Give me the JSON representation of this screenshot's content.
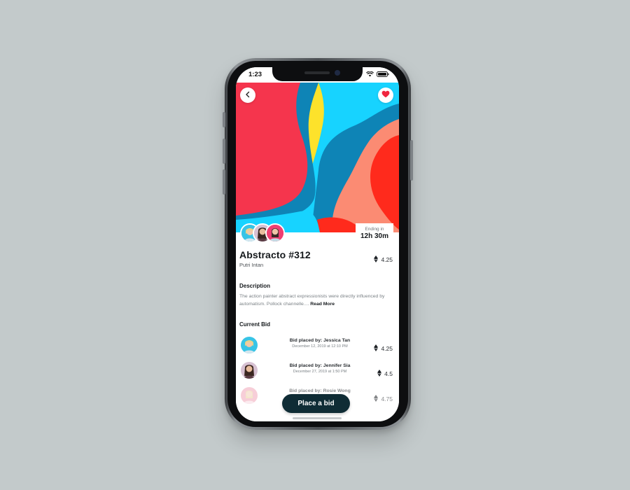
{
  "status_bar": {
    "time": "1:23"
  },
  "artwork": {
    "title": "Abstracto #312",
    "artist": "Putri Intan",
    "price": "4.25",
    "ending_label": "Ending in",
    "ending_value": "12h 30m"
  },
  "description": {
    "title": "Description",
    "text": "The action painter abstract expressionists were directly influenced by automatism. Pollock channelle....",
    "read_more": "Read More"
  },
  "current_bid": {
    "title": "Current Bid",
    "bids": [
      {
        "by": "Bid placed by: Jessica Tan",
        "date": "December 12, 2019 at 12:10 PM",
        "price": "4.25"
      },
      {
        "by": "Bid placed by: Jennifer Sia",
        "date": "December 27, 2019 at 1:50 PM",
        "price": "4.5"
      },
      {
        "by": "Bid placed by: Rosie Wong",
        "date": "",
        "price": "4.75"
      }
    ]
  },
  "actions": {
    "place_bid": "Place a bid"
  },
  "colors": {
    "art_red": "#f5354d",
    "art_yellow": "#fde22b",
    "art_cyan": "#17d3ff",
    "art_blue": "#0e84b6",
    "art_salmon": "#fb8b73",
    "art_orange_red": "#ff2a1c",
    "button_dark": "#0f2c35",
    "like_red": "#f0263f"
  }
}
